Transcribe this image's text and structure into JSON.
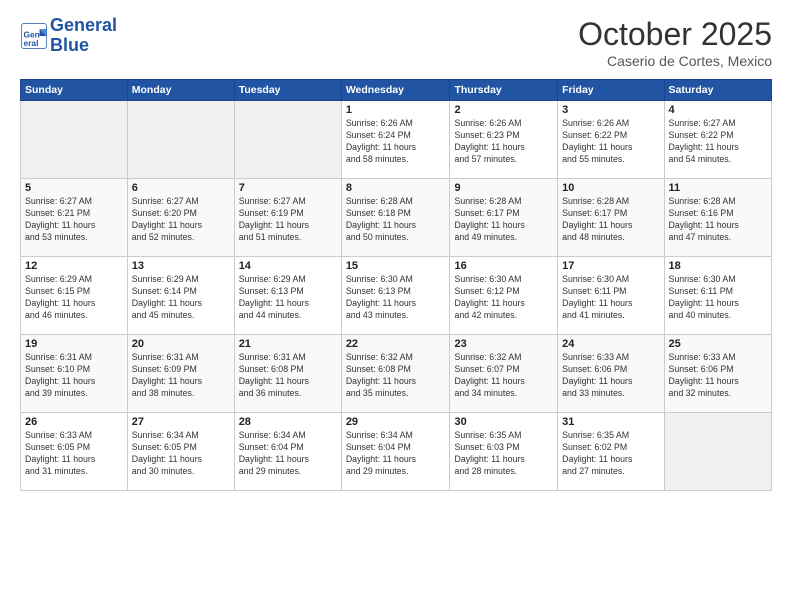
{
  "header": {
    "logo_line1": "General",
    "logo_line2": "Blue",
    "month_title": "October 2025",
    "subtitle": "Caserio de Cortes, Mexico"
  },
  "days_of_week": [
    "Sunday",
    "Monday",
    "Tuesday",
    "Wednesday",
    "Thursday",
    "Friday",
    "Saturday"
  ],
  "weeks": [
    [
      {
        "day": "",
        "info": ""
      },
      {
        "day": "",
        "info": ""
      },
      {
        "day": "",
        "info": ""
      },
      {
        "day": "1",
        "info": "Sunrise: 6:26 AM\nSunset: 6:24 PM\nDaylight: 11 hours\nand 58 minutes."
      },
      {
        "day": "2",
        "info": "Sunrise: 6:26 AM\nSunset: 6:23 PM\nDaylight: 11 hours\nand 57 minutes."
      },
      {
        "day": "3",
        "info": "Sunrise: 6:26 AM\nSunset: 6:22 PM\nDaylight: 11 hours\nand 55 minutes."
      },
      {
        "day": "4",
        "info": "Sunrise: 6:27 AM\nSunset: 6:22 PM\nDaylight: 11 hours\nand 54 minutes."
      }
    ],
    [
      {
        "day": "5",
        "info": "Sunrise: 6:27 AM\nSunset: 6:21 PM\nDaylight: 11 hours\nand 53 minutes."
      },
      {
        "day": "6",
        "info": "Sunrise: 6:27 AM\nSunset: 6:20 PM\nDaylight: 11 hours\nand 52 minutes."
      },
      {
        "day": "7",
        "info": "Sunrise: 6:27 AM\nSunset: 6:19 PM\nDaylight: 11 hours\nand 51 minutes."
      },
      {
        "day": "8",
        "info": "Sunrise: 6:28 AM\nSunset: 6:18 PM\nDaylight: 11 hours\nand 50 minutes."
      },
      {
        "day": "9",
        "info": "Sunrise: 6:28 AM\nSunset: 6:17 PM\nDaylight: 11 hours\nand 49 minutes."
      },
      {
        "day": "10",
        "info": "Sunrise: 6:28 AM\nSunset: 6:17 PM\nDaylight: 11 hours\nand 48 minutes."
      },
      {
        "day": "11",
        "info": "Sunrise: 6:28 AM\nSunset: 6:16 PM\nDaylight: 11 hours\nand 47 minutes."
      }
    ],
    [
      {
        "day": "12",
        "info": "Sunrise: 6:29 AM\nSunset: 6:15 PM\nDaylight: 11 hours\nand 46 minutes."
      },
      {
        "day": "13",
        "info": "Sunrise: 6:29 AM\nSunset: 6:14 PM\nDaylight: 11 hours\nand 45 minutes."
      },
      {
        "day": "14",
        "info": "Sunrise: 6:29 AM\nSunset: 6:13 PM\nDaylight: 11 hours\nand 44 minutes."
      },
      {
        "day": "15",
        "info": "Sunrise: 6:30 AM\nSunset: 6:13 PM\nDaylight: 11 hours\nand 43 minutes."
      },
      {
        "day": "16",
        "info": "Sunrise: 6:30 AM\nSunset: 6:12 PM\nDaylight: 11 hours\nand 42 minutes."
      },
      {
        "day": "17",
        "info": "Sunrise: 6:30 AM\nSunset: 6:11 PM\nDaylight: 11 hours\nand 41 minutes."
      },
      {
        "day": "18",
        "info": "Sunrise: 6:30 AM\nSunset: 6:11 PM\nDaylight: 11 hours\nand 40 minutes."
      }
    ],
    [
      {
        "day": "19",
        "info": "Sunrise: 6:31 AM\nSunset: 6:10 PM\nDaylight: 11 hours\nand 39 minutes."
      },
      {
        "day": "20",
        "info": "Sunrise: 6:31 AM\nSunset: 6:09 PM\nDaylight: 11 hours\nand 38 minutes."
      },
      {
        "day": "21",
        "info": "Sunrise: 6:31 AM\nSunset: 6:08 PM\nDaylight: 11 hours\nand 36 minutes."
      },
      {
        "day": "22",
        "info": "Sunrise: 6:32 AM\nSunset: 6:08 PM\nDaylight: 11 hours\nand 35 minutes."
      },
      {
        "day": "23",
        "info": "Sunrise: 6:32 AM\nSunset: 6:07 PM\nDaylight: 11 hours\nand 34 minutes."
      },
      {
        "day": "24",
        "info": "Sunrise: 6:33 AM\nSunset: 6:06 PM\nDaylight: 11 hours\nand 33 minutes."
      },
      {
        "day": "25",
        "info": "Sunrise: 6:33 AM\nSunset: 6:06 PM\nDaylight: 11 hours\nand 32 minutes."
      }
    ],
    [
      {
        "day": "26",
        "info": "Sunrise: 6:33 AM\nSunset: 6:05 PM\nDaylight: 11 hours\nand 31 minutes."
      },
      {
        "day": "27",
        "info": "Sunrise: 6:34 AM\nSunset: 6:05 PM\nDaylight: 11 hours\nand 30 minutes."
      },
      {
        "day": "28",
        "info": "Sunrise: 6:34 AM\nSunset: 6:04 PM\nDaylight: 11 hours\nand 29 minutes."
      },
      {
        "day": "29",
        "info": "Sunrise: 6:34 AM\nSunset: 6:04 PM\nDaylight: 11 hours\nand 29 minutes."
      },
      {
        "day": "30",
        "info": "Sunrise: 6:35 AM\nSunset: 6:03 PM\nDaylight: 11 hours\nand 28 minutes."
      },
      {
        "day": "31",
        "info": "Sunrise: 6:35 AM\nSunset: 6:02 PM\nDaylight: 11 hours\nand 27 minutes."
      },
      {
        "day": "",
        "info": ""
      }
    ]
  ]
}
